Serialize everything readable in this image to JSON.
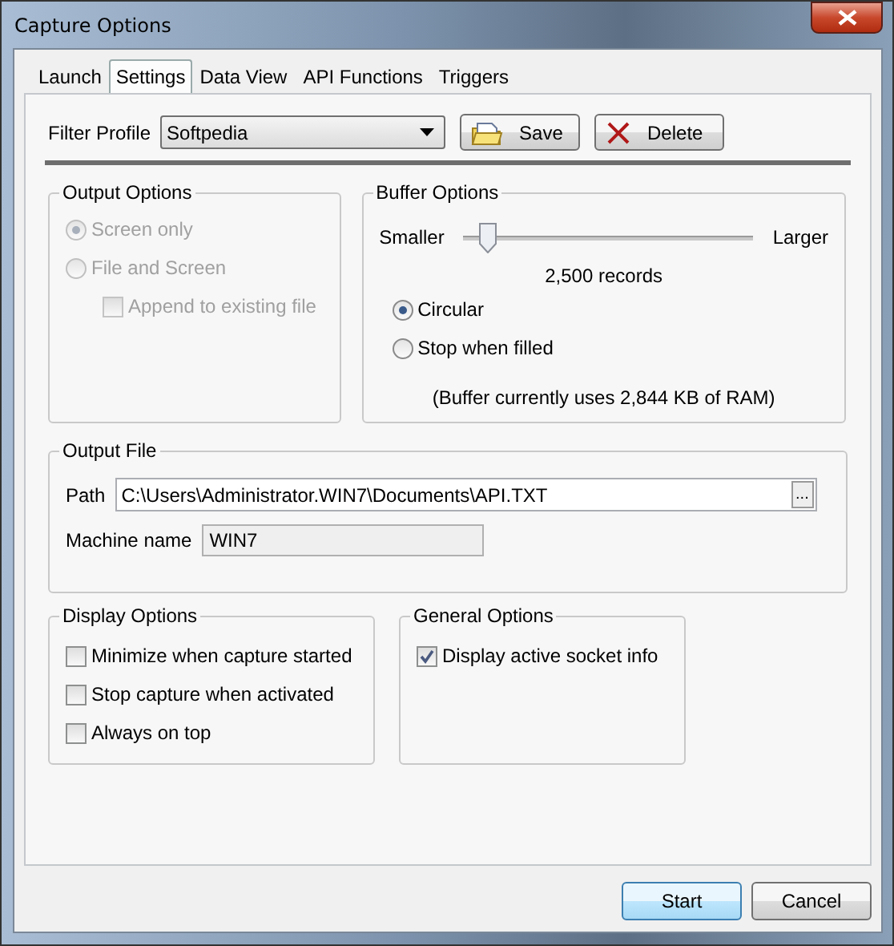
{
  "window": {
    "title": "Capture Options"
  },
  "tabs": [
    {
      "label": "Launch",
      "selected": false
    },
    {
      "label": "Settings",
      "selected": true
    },
    {
      "label": "Data View",
      "selected": false
    },
    {
      "label": "API Functions",
      "selected": false
    },
    {
      "label": "Triggers",
      "selected": false
    }
  ],
  "filter_profile": {
    "label": "Filter Profile",
    "value": "Softpedia"
  },
  "profile_buttons": [
    {
      "label": "Save",
      "kind": "save"
    },
    {
      "label": "Delete",
      "kind": "delete"
    }
  ],
  "output_options": {
    "title": "Output Options",
    "options": [
      {
        "label": "Screen only",
        "kind": "radio",
        "selected": true,
        "disabled": true
      },
      {
        "label": "File and Screen",
        "kind": "radio",
        "selected": false,
        "disabled": true
      },
      {
        "label": "Append to existing file",
        "kind": "checkbox",
        "checked": false,
        "disabled": true
      }
    ]
  },
  "buffer_options": {
    "title": "Buffer Options",
    "slider": {
      "min_label": "Smaller",
      "max_label": "Larger",
      "level": 0.08
    },
    "records": "2,500 records",
    "modes": [
      {
        "label": "Circular",
        "selected": true
      },
      {
        "label": "Stop when filled",
        "selected": false
      }
    ],
    "note": "(Buffer currently uses 2,844 KB of RAM)"
  },
  "output_file": {
    "title": "Output File",
    "path": {
      "label": "Path",
      "value": "C:\\Users\\Administrator.WIN7\\Documents\\API.TXT",
      "browse": "..."
    },
    "machine_name": {
      "label": "Machine name",
      "value": "WIN7"
    }
  },
  "display_options": {
    "title": "Display Options",
    "options": [
      {
        "label": "Minimize when capture started",
        "checked": false
      },
      {
        "label": "Stop capture when activated",
        "checked": false
      },
      {
        "label": "Always on top",
        "checked": false
      }
    ]
  },
  "general_options": {
    "title": "General Options",
    "options": [
      {
        "label": "Display active socket info",
        "checked": true
      }
    ]
  },
  "buttons": [
    {
      "label": "Start",
      "default": true
    },
    {
      "label": "Cancel",
      "default": false
    }
  ]
}
